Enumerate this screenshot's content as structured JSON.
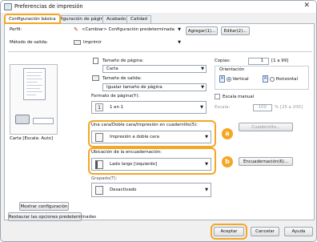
{
  "window": {
    "title": "Preferencias de impresión",
    "close_glyph": "✕"
  },
  "tabs": [
    {
      "label": "Configuración básica"
    },
    {
      "label": "onfiguración de página"
    },
    {
      "label": "Acabado"
    },
    {
      "label": "Calidad"
    }
  ],
  "profile": {
    "label": "Perfil:",
    "value": "<Cambiar> Configuración predeterminada",
    "add_label": "Agregar(1)...",
    "edit_label": "Editar(2)..."
  },
  "output": {
    "label": "Método de salida:",
    "value": "Imprimir"
  },
  "preview": {
    "caption": "Carta [Escala: Auto]"
  },
  "page_size": {
    "label": "Tamaño de página:",
    "value": "Carta"
  },
  "output_size": {
    "label": "Tamaño de salida:",
    "value": "Igualar tamaño de página"
  },
  "copies": {
    "label": "Copias:",
    "value": "1",
    "range": "[1 a 99]"
  },
  "orientation": {
    "label": "Orientación",
    "vertical": "Vertical",
    "horizontal": "Horizontal",
    "vertical_glyph": "A",
    "horizontal_glyph": "A"
  },
  "layout": {
    "label": "Formato de página(Y):",
    "value": "1 en 1",
    "icon_text": "1"
  },
  "manual_scale": {
    "label": "Escala manual",
    "scale_label": "Escala:",
    "scale_value": "100",
    "scale_range": "% [25 a 200]"
  },
  "duplex": {
    "label": "Una cara/Doble cara/Impresión en cuadernillo(5):",
    "value": "Impresión a doble cara",
    "booklet_button": "Cuadernillo..."
  },
  "binding": {
    "label": "Ubicación de la encuadernación:",
    "value": "Lado largo [izquierdo]",
    "button": "Encuadernación(6)..."
  },
  "staple": {
    "label": "Grapado(T):",
    "value": "Desactivado"
  },
  "left_buttons": {
    "show_settings": "Mostrar configuración",
    "restore_defaults": "Restaurar las opciones predeterminadas"
  },
  "callouts": {
    "a": "a",
    "b": "b"
  },
  "footer": {
    "accept": "Aceptar",
    "cancel": "Cancelar",
    "help": "Ayuda"
  },
  "colors": {
    "highlight": "#f5a623",
    "accent": "#2b6fd6"
  }
}
